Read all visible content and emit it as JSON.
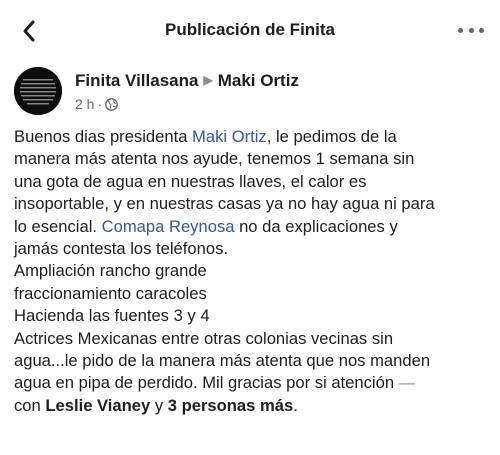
{
  "header": {
    "title": "Publicación de Finita"
  },
  "post": {
    "author": "Finita Villasana",
    "separator_arrow": "▶",
    "target": "Maki Ortiz",
    "time": "2 h",
    "dot": "·",
    "privacy_icon": "globe-icon",
    "lines": {
      "l1a": "Buenos dias presidenta ",
      "l1link": "Maki Ortiz",
      "l1b": ", le pedimos de la",
      "l2": "manera más atenta nos ayude, tenemos 1 semana sin",
      "l3": "una gota de agua en nuestras llaves, el calor es",
      "l4": "insoportable, y en nuestras casas ya no hay agua ni para",
      "l5a": "lo esencial. ",
      "l5link": "Comapa Reynosa",
      "l5b": " no da explicaciones y",
      "l6": "jamás  contesta los teléfonos.",
      "l7": "Ampliación  rancho grande",
      "l8": "fraccionamiento caracoles",
      "l9": "Hacienda las fuentes 3 y 4",
      "l10": "Actrices Mexicanas entre otras colonias vecinas sin",
      "l11": "agua...le pido de la manera más atenta que nos manden",
      "l12a": "agua en pipa de perdido. Mil gracias por si atención ",
      "l12dash": "—",
      "l13a": "con ",
      "l13tag1": "Leslie Vianey",
      "l13b": " y ",
      "l13tag2": "3 personas más",
      "l13c": "."
    }
  },
  "colors": {
    "link": "#385898",
    "text": "#1c1e21",
    "secondary": "#65676b"
  }
}
